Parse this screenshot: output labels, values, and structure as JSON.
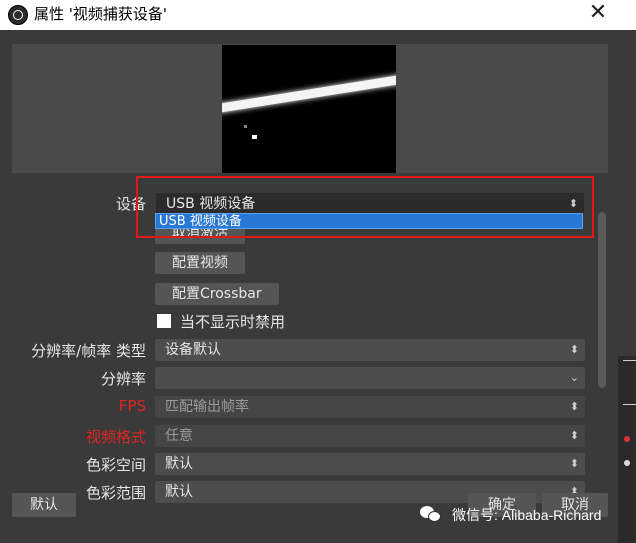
{
  "window": {
    "title": "属性 '视频捕获设备'",
    "close_glyph": "✕"
  },
  "form": {
    "device_label": "设备",
    "device_value": "USB 视频设备",
    "device_dropdown_items": [
      "USB 视频设备"
    ],
    "deactivate_button": "取消激活",
    "configure_video_button": "配置视频",
    "configure_crossbar_button": "配置Crossbar",
    "deactivate_when_hidden_label": "当不显示时禁用",
    "resolution_fps_type_label": "分辨率/帧率 类型",
    "resolution_fps_type_value": "设备默认",
    "resolution_label": "分辨率",
    "resolution_value": "",
    "fps_label": "FPS",
    "fps_value": "匹配输出帧率",
    "video_format_label": "视频格式",
    "video_format_value": "任意",
    "color_space_label": "色彩空间",
    "color_space_value": "默认",
    "color_range_label": "色彩范围",
    "color_range_value": "默认"
  },
  "footer": {
    "defaults_button": "默认",
    "ok_button": "确定",
    "cancel_button": "取消"
  },
  "watermark": {
    "text": "微信号: Alibaba-Richard"
  },
  "colors": {
    "highlight_border": "#e01818",
    "selection": "#2a78d6",
    "label_red": "#e02424"
  }
}
